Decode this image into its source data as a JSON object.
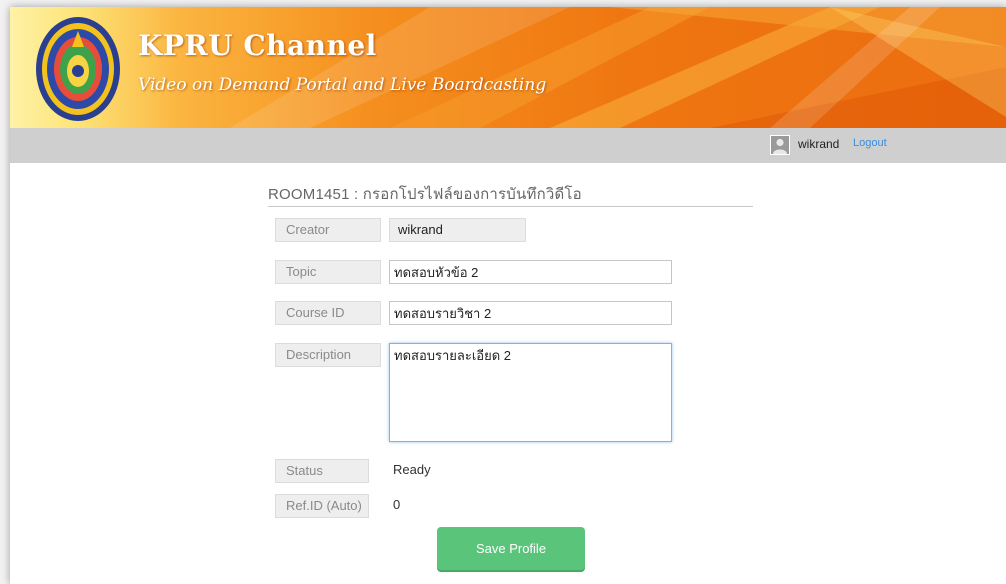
{
  "header": {
    "title": "KPRU Channel",
    "subtitle": "Video on Demand Portal and Live Boardcasting"
  },
  "userbar": {
    "username": "wikrand",
    "logout_label": "Logout"
  },
  "form": {
    "page_title": "ROOM1451 : กรอกโปรไฟล์ของการบันทึกวิดีโอ",
    "creator": {
      "label": "Creator",
      "value": "wikrand"
    },
    "topic": {
      "label": "Topic",
      "value": "ทดสอบหัวข้อ 2"
    },
    "course_id": {
      "label": "Course ID",
      "value": "ทดสอบรายวิชา 2"
    },
    "description": {
      "label": "Description",
      "value": "ทดสอบรายละเอียด 2"
    },
    "status": {
      "label": "Status",
      "value": "Ready"
    },
    "ref_id": {
      "label": "Ref.ID (Auto)",
      "value": "0"
    },
    "save_label": "Save Profile"
  },
  "colors": {
    "banner_orange": "#ef7611",
    "save_button": "#5bc47b",
    "logout_link": "#3a8de0",
    "userbar": "#cfcfcf"
  },
  "icons": [
    "university-seal-logo",
    "user-avatar-icon"
  ]
}
